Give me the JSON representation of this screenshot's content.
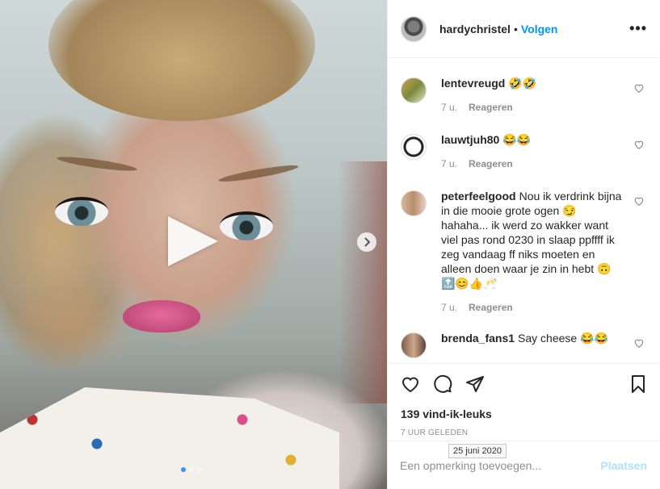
{
  "media": {
    "type": "video",
    "carousel_dots": 3,
    "active_dot": 0
  },
  "post": {
    "owner": "hardychristel",
    "bullet": "•",
    "follow_label": "Volgen",
    "more_label": "•••",
    "likes": "139 vind-ik-leuks",
    "time_ago": "7 UUR GELEDEN",
    "date_tooltip": "25 juni 2020"
  },
  "comments": [
    {
      "username": "lentevreugd",
      "text": "🤣🤣",
      "age": "7 u.",
      "reply_label": "Reageren"
    },
    {
      "username": "lauwtjuh80",
      "text": "😂😂",
      "age": "7 u.",
      "reply_label": "Reageren"
    },
    {
      "username": "peterfeelgood",
      "text": "Nou ik verdrink bijna in die mooie grote ogen 😏 hahaha... ik werd zo wakker want viel pas rond 0230 in slaap ppffff ik zeg vandaag ff niks moeten en alleen doen waar je zin in hebt 🙃 🔝😊👍🥂",
      "age": "7 u.",
      "reply_label": "Reageren"
    },
    {
      "username": "brenda_fans1",
      "text": "Say cheese 😂😂",
      "age": "",
      "reply_label": ""
    }
  ],
  "comment_box": {
    "placeholder": "Een opmerking toevoegen...",
    "post_label": "Plaatsen"
  },
  "icons": [
    "heart-icon",
    "comment-icon",
    "share-icon",
    "bookmark-icon",
    "play-icon",
    "chevron-right-icon",
    "more-icon"
  ],
  "colors": {
    "link_blue": "#0095f6",
    "post_disabled": "#b2dffc",
    "muted": "#8e8e8e",
    "text": "#262626",
    "active_dot": "#3897f0"
  }
}
